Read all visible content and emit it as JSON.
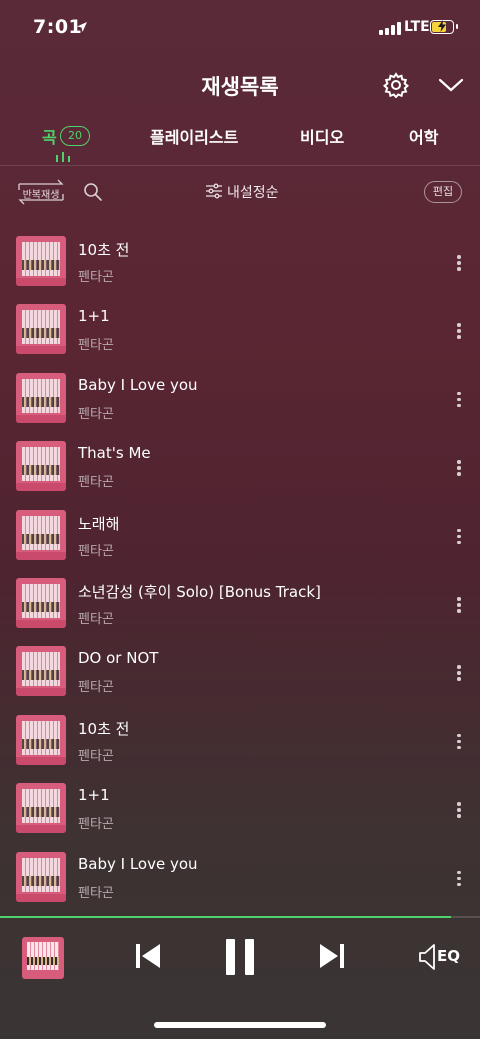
{
  "status_bar": {
    "time": "7:01",
    "network": "LTE",
    "location_icon": "location-arrow-icon",
    "battery_icon": "battery-charging-icon",
    "signal_icon": "signal-bars-icon"
  },
  "header": {
    "title": "재생목록",
    "settings_icon": "gear-icon",
    "collapse_icon": "chevron-down-icon"
  },
  "tabs": [
    {
      "label": "곡",
      "count": "20",
      "active": true
    },
    {
      "label": "플레이리스트"
    },
    {
      "label": "비디오"
    },
    {
      "label": "어학"
    }
  ],
  "toolbar": {
    "repeat_label": "반복재생",
    "search_icon": "search-icon",
    "sort_icon": "sliders-icon",
    "sort_label": "내설정순",
    "edit_label": "편집"
  },
  "songs": [
    {
      "title": "10초 전",
      "artist": "펜타곤"
    },
    {
      "title": "1+1",
      "artist": "펜타곤"
    },
    {
      "title": "Baby I Love you",
      "artist": "펜타곤"
    },
    {
      "title": "That's Me",
      "artist": "펜타곤"
    },
    {
      "title": "노래해",
      "artist": "펜타곤"
    },
    {
      "title": "소년감성 (후이 Solo) [Bonus Track]",
      "artist": "펜타곤"
    },
    {
      "title": "DO or NOT",
      "artist": "펜타곤"
    },
    {
      "title": "10초 전",
      "artist": "펜타곤"
    },
    {
      "title": "1+1",
      "artist": "펜타곤"
    },
    {
      "title": "Baby I Love you",
      "artist": "펜타곤"
    }
  ],
  "player": {
    "progress": 0.94,
    "prev_icon": "skip-previous-icon",
    "pause_icon": "pause-icon",
    "next_icon": "skip-next-icon",
    "eq_label": "EQ",
    "accent_color": "#4fd26c"
  }
}
